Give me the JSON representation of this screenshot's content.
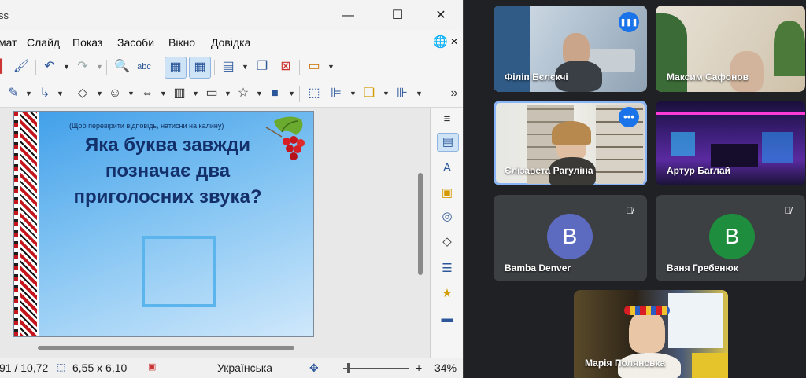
{
  "impress": {
    "window_title": "ss",
    "window_controls": {
      "minimize": "—",
      "maximize": "☐",
      "close": "✕"
    },
    "menu": {
      "format": "мат",
      "slide": "Слайд",
      "show": "Показ",
      "tools": "Засоби",
      "window": "Вікно",
      "help": "Довідка"
    },
    "menu_right": {
      "globe": "🌐",
      "close": "✕"
    },
    "slide": {
      "hint": "(Щоб перевірити відповідь, натисни на калину)",
      "question": "Яка буква завжди позначає два приголосних звука?"
    },
    "status": {
      "position": "91 / 10,72",
      "size": "6,55 x 6,10",
      "language": "Українська",
      "zoom_minus": "–",
      "zoom_plus": "+",
      "zoom": "34%"
    }
  },
  "meet": {
    "participants": [
      {
        "name": "Філіп Бєлєкчі",
        "type": "video",
        "speaking": false,
        "badge": "❚❚❚"
      },
      {
        "name": "Максим Сафонов",
        "type": "video",
        "speaking": false
      },
      {
        "name": "Єлізавета Рагуліна",
        "type": "video",
        "speaking": true,
        "badge": "•••"
      },
      {
        "name": "Артур Баглай",
        "type": "video",
        "speaking": false
      },
      {
        "name": "Bamba Denver",
        "type": "avatar",
        "initial": "B",
        "color": "#5c6bc0",
        "muted": true
      },
      {
        "name": "Ваня Гребенюк",
        "type": "avatar",
        "initial": "B",
        "color": "#1e8e3e",
        "muted": true
      },
      {
        "name": "Марія Полянська",
        "type": "video",
        "speaking": false
      }
    ]
  },
  "colors": {
    "meet_bg": "#202124",
    "tile_bg": "#3c4043",
    "speaking_outline": "#8ab4f8",
    "slide_title": "#14306a"
  }
}
